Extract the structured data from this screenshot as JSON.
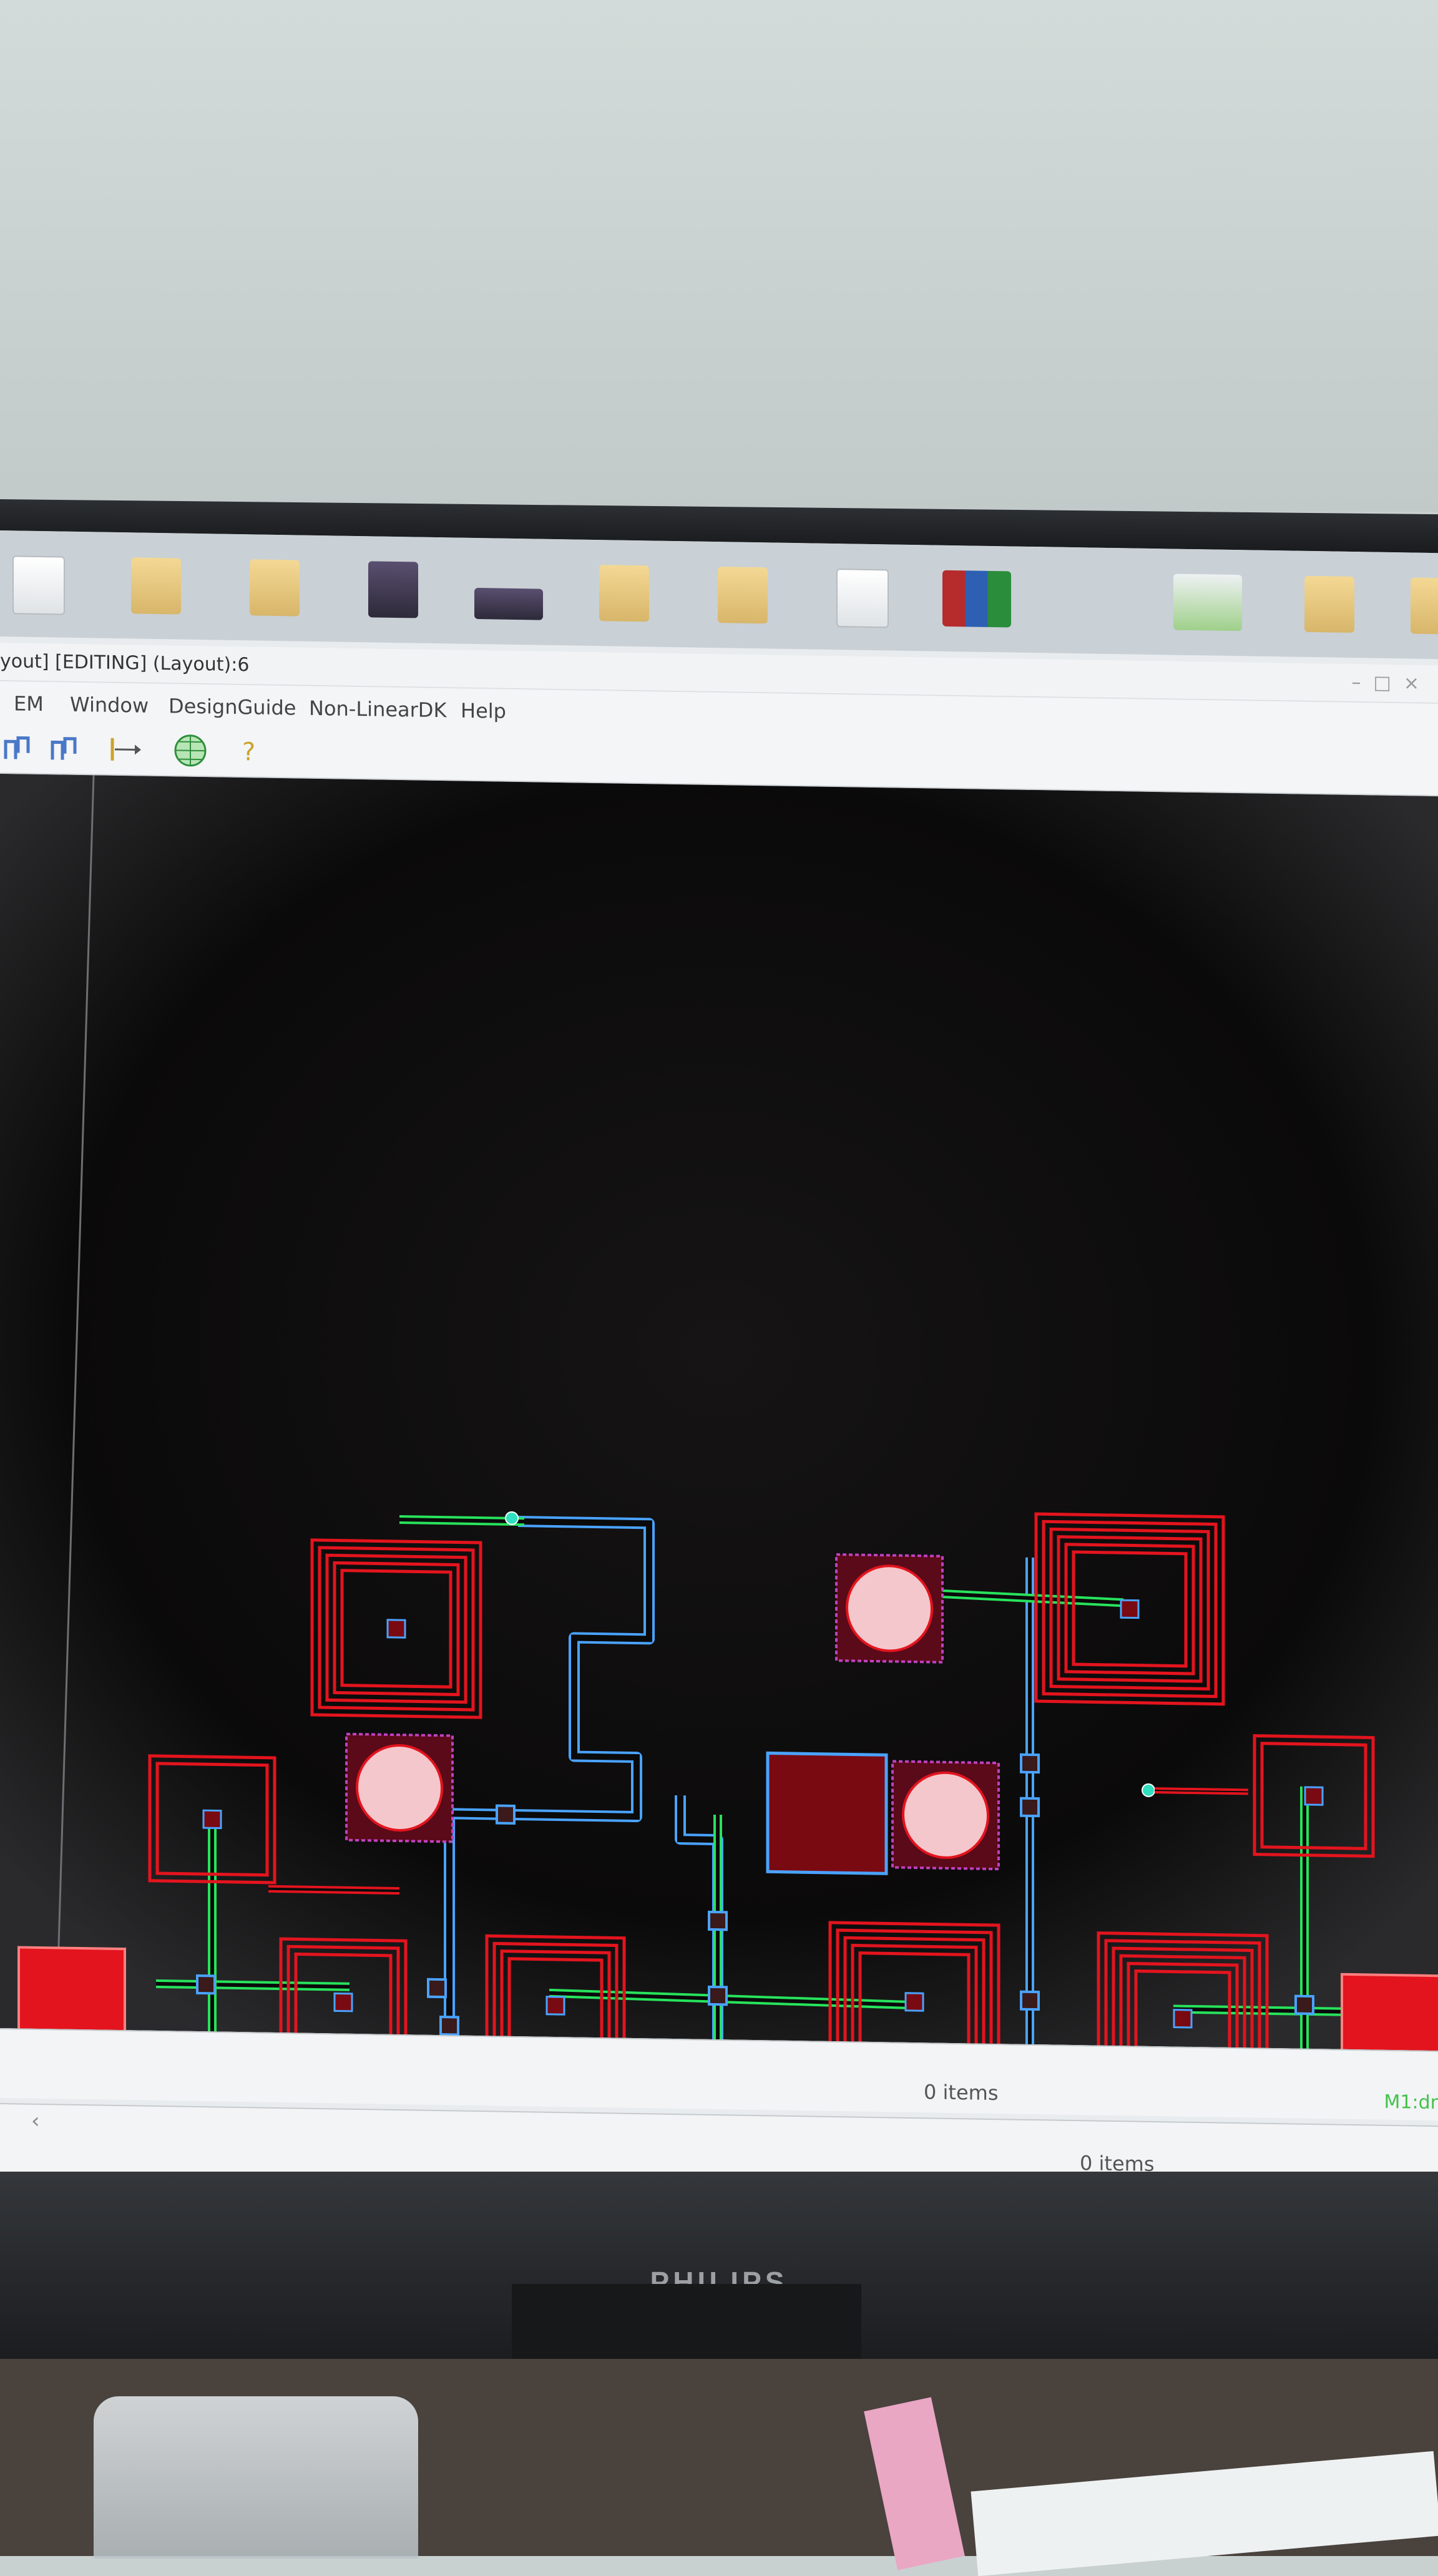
{
  "window": {
    "title": "yout] [EDITING] (Layout):6",
    "controls": [
      "–",
      "□",
      "×"
    ]
  },
  "menu": [
    "EM",
    "Window",
    "DesignGuide",
    "Non-LinearDK",
    "Help"
  ],
  "toolbar": {
    "icons": [
      "layout-tool-icon",
      "layout-tool-2-icon",
      "insert-port-icon",
      "globe-icon",
      "help-icon"
    ]
  },
  "status": {
    "items_top": "0 items",
    "items_bottom": "0 items",
    "layer": "M1:dr"
  },
  "monitor": {
    "brand": "PHILIPS"
  },
  "colors": {
    "metal": "#e3141e",
    "via_fill": "#7a0a12",
    "line_blue": "#4aa3ff",
    "line_green": "#27e35c",
    "pad_fill": "#f4c7cc"
  }
}
